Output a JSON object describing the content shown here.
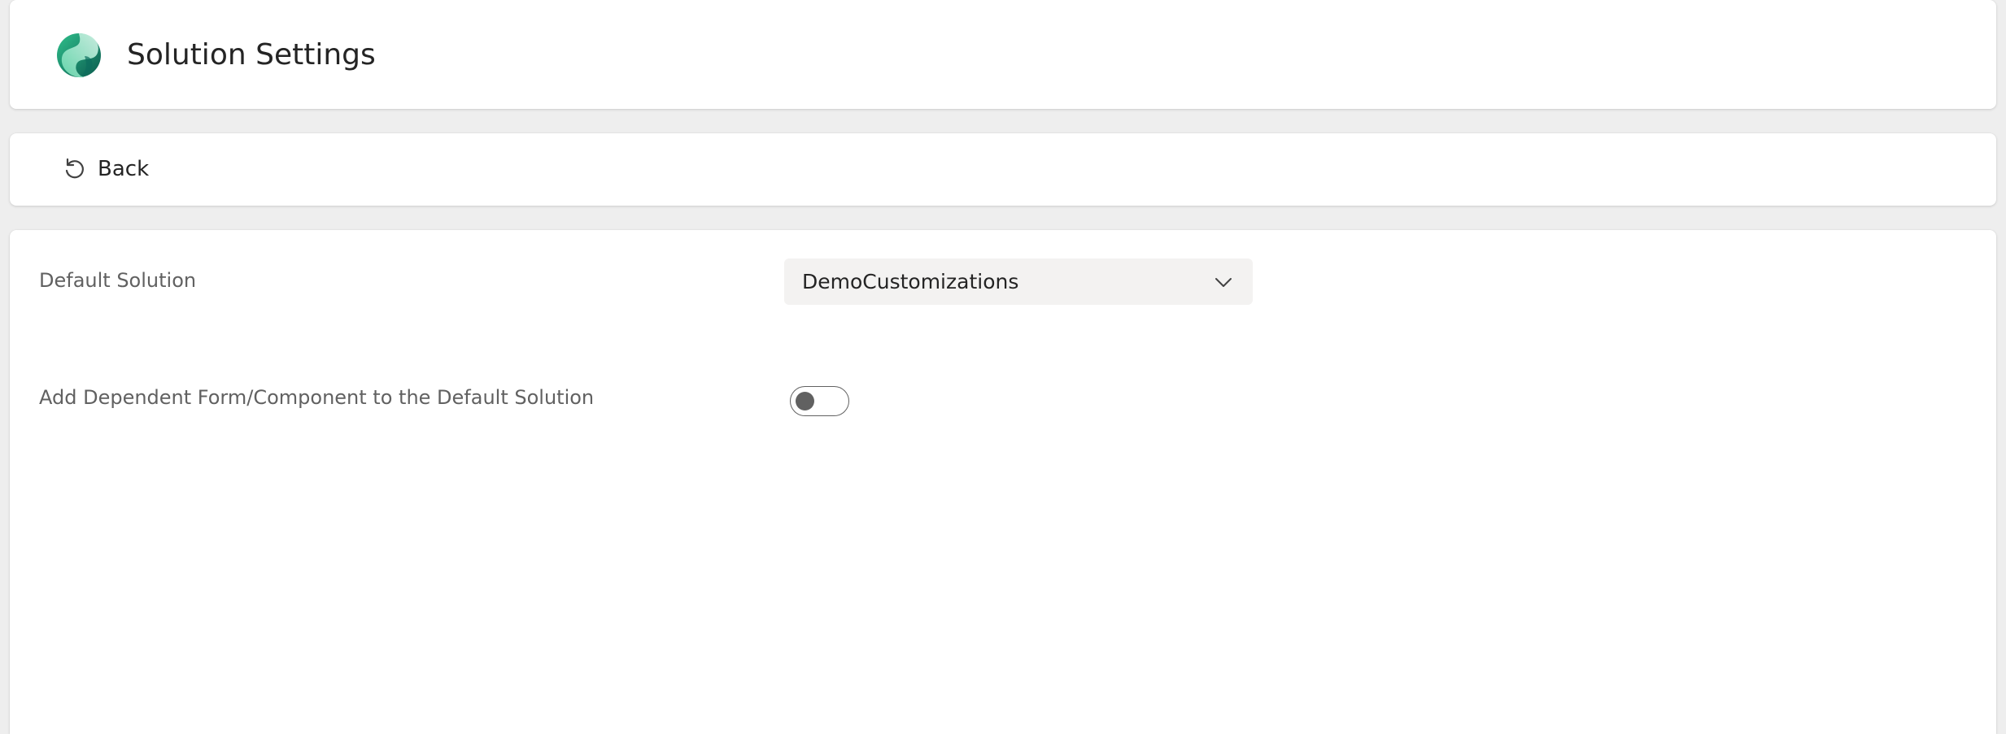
{
  "header": {
    "title": "Solution Settings",
    "logo_icon": "dynamics-swirl-logo-icon"
  },
  "toolbar": {
    "back_label": "Back",
    "back_icon": "undo-arrow-icon"
  },
  "settings": {
    "default_solution": {
      "label": "Default Solution",
      "selected_value": "DemoCustomizations",
      "chevron_icon": "chevron-down-icon"
    },
    "add_dependent": {
      "label": "Add Dependent Form/Component to the Default Solution",
      "enabled": false
    }
  },
  "colors": {
    "background": "#eeeeee",
    "card": "#ffffff",
    "dropdown_bg": "#f3f2f1",
    "text_primary": "#242424",
    "text_secondary": "#616161",
    "logo_dark": "#0b5b4f",
    "logo_light": "#3fcf9b"
  }
}
